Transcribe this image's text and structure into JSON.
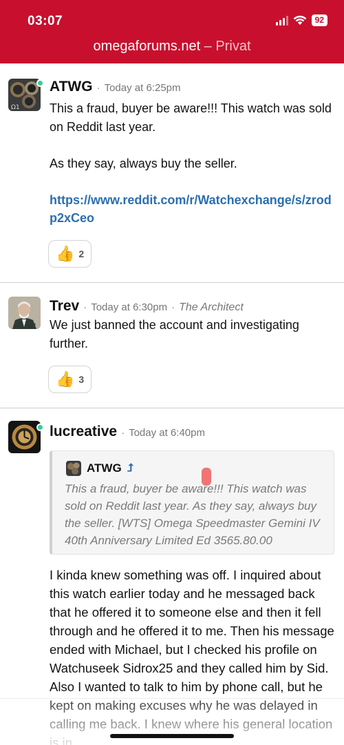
{
  "status_bar": {
    "time": "03:07",
    "battery": "92"
  },
  "browser": {
    "domain": "omegaforums.net",
    "separator": " – ",
    "mode": "Privat"
  },
  "colors": {
    "brand": "#c8102e",
    "link": "#2b6fb0",
    "online": "#2fcf9a"
  },
  "posts": [
    {
      "username": "ATWG",
      "time": "Today at 6:25pm",
      "paragraphs": [
        "This a fraud, buyer be aware!!! This watch was sold on Reddit last year.",
        "As they say, always buy the seller."
      ],
      "link": "https://www.reddit.com/r/Watchexchange/s/zrodp2xCeo",
      "reaction_icon": "thumbs-up-icon",
      "reaction_count": "2",
      "avatar_icon": "watch-avatar-icon"
    },
    {
      "username": "Trev",
      "time": "Today at 6:30pm",
      "role": "The Architect",
      "paragraphs": [
        "We just banned the account and investigating further."
      ],
      "reaction_icon": "thumbs-up-icon",
      "reaction_count": "3",
      "avatar_icon": "portrait-avatar-icon"
    },
    {
      "username": "lucreative",
      "time": "Today at 6:40pm",
      "avatar_icon": "watch-dial-avatar-icon",
      "quote": {
        "username": "ATWG",
        "text": "This a fraud, buyer be aware!!! This watch was sold on Reddit last year. As they say, always buy the seller. [WTS] Omega Speedmaster Gemini IV 40th Anniversary Limited Ed 3565.80.00"
      },
      "body": "I kinda knew something was off. I inquired about this watch earlier today and he messaged back that he offered it to someone else and then it fell through and he offered it to me. Then his message ended with Michael, but I checked his profile on Watchuseek Sidrox25 and they called him by Sid. Also I wanted to talk to him by phone call, but he kept on making excuses why he was delayed in calling me back. I knew where his general location is in"
    }
  ]
}
